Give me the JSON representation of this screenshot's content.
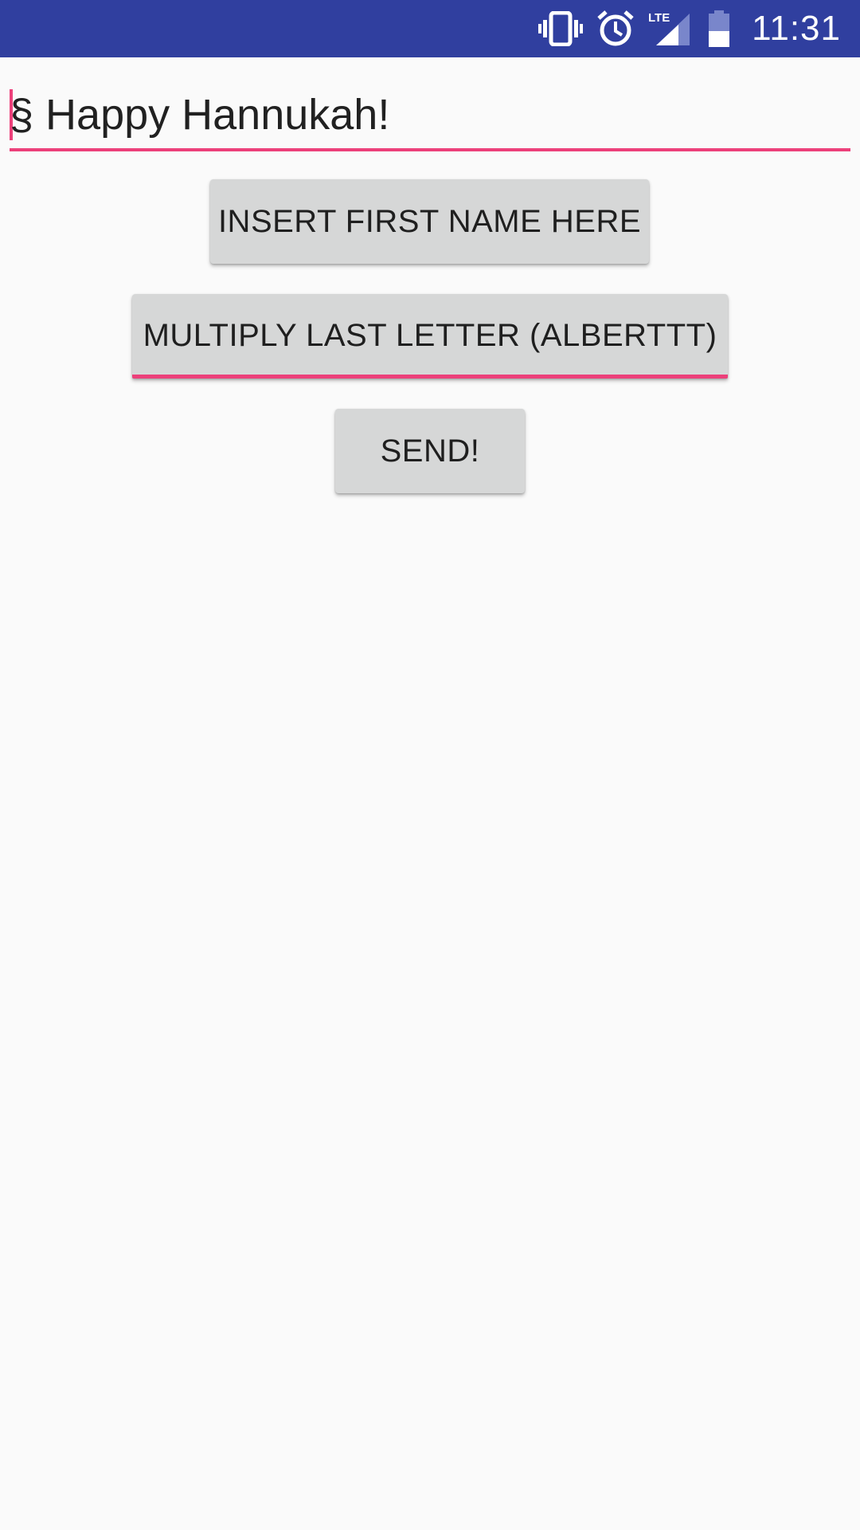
{
  "status_bar": {
    "time": "11:31",
    "icons": [
      "vibrate-icon",
      "alarm-icon",
      "lte-signal-icon",
      "battery-icon"
    ],
    "network_label": "LTE",
    "color": "#303f9f"
  },
  "message_field": {
    "value": "§ Happy Hannukah!",
    "accent_color": "#ec407a"
  },
  "buttons": {
    "insert_label": "INSERT FIRST NAME HERE",
    "multiply_label": "MULTIPLY LAST LETTER (ALBERTTT)",
    "send_label": "SEND!"
  }
}
